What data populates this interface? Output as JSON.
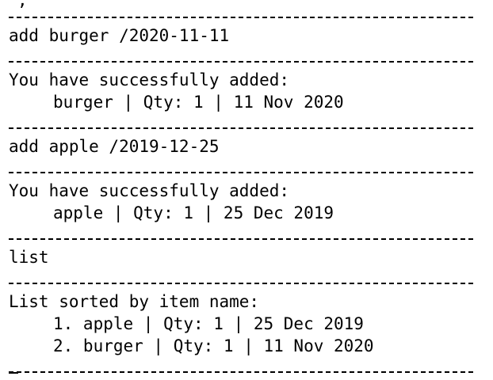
{
  "terminal": {
    "lines": {
      "cmd1": "add burger /2020-11-11",
      "resp1_header": "You have successfully added:",
      "resp1_item": "burger | Qty: 1 | 11 Nov 2020",
      "cmd2": "add apple /2019-12-25",
      "resp2_header": "You have successfully added:",
      "resp2_item": "apple | Qty: 1 | 25 Dec 2019",
      "cmd3": "list",
      "list_header": "List sorted by item name:",
      "list_item1": "1. apple | Qty: 1 | 25 Dec 2019",
      "list_item2": "2. burger | Qty: 1 | 11 Nov 2020"
    }
  }
}
